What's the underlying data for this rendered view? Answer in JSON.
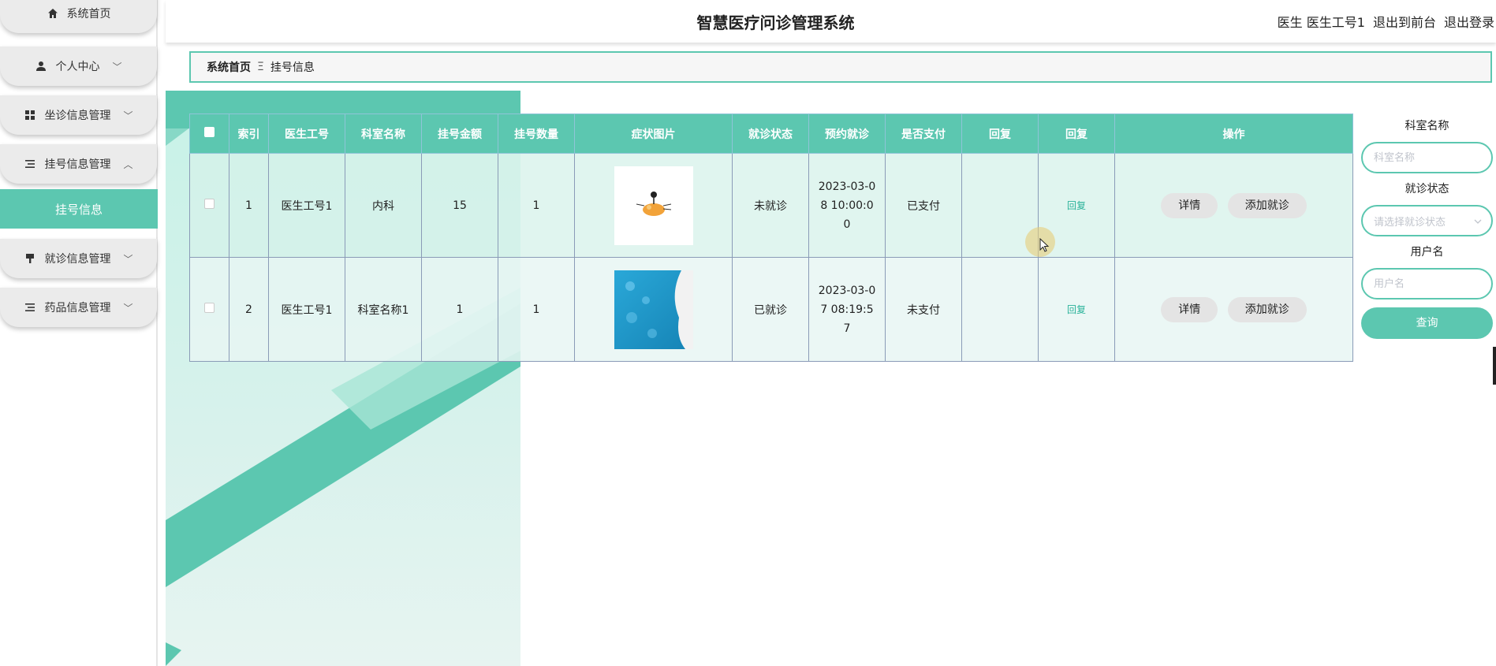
{
  "header": {
    "title": "智慧医疗问诊管理系统",
    "user_role": "医生",
    "user_name": "医生工号1",
    "back_to_front": "退出到前台",
    "logout": "退出登录"
  },
  "sidebar": {
    "items": [
      {
        "label": "系统首页",
        "icon": "home-icon"
      },
      {
        "label": "个人中心",
        "icon": "user-icon",
        "chevron": "﹀"
      },
      {
        "label": "坐诊信息管理",
        "icon": "grid-icon",
        "chevron": "﹀"
      },
      {
        "label": "挂号信息管理",
        "icon": "list-icon",
        "chevron": "︿"
      },
      {
        "label": "就诊信息管理",
        "icon": "brush-icon",
        "chevron": "﹀"
      },
      {
        "label": "药品信息管理",
        "icon": "list-icon",
        "chevron": "﹀"
      }
    ],
    "active_sub": "挂号信息"
  },
  "breadcrumb": {
    "home": "系统首页",
    "separator": "Ξ",
    "current": "挂号信息"
  },
  "table": {
    "headers": [
      "索引",
      "医生工号",
      "科室名称",
      "挂号金额",
      "挂号数量",
      "症状图片",
      "就诊状态",
      "预约就诊",
      "是否支付",
      "回复",
      "回复",
      "操作"
    ],
    "rows": [
      {
        "index": "1",
        "doctor_id": "医生工号1",
        "department": "内科",
        "amount": "15",
        "quantity": "1",
        "image": "cartoon-image",
        "status": "未就诊",
        "appointment": "2023-03-08 10:00:00",
        "paid": "已支付",
        "reply_text": "",
        "reply_link": "回复",
        "btn_detail": "详情",
        "btn_add": "添加就诊"
      },
      {
        "index": "2",
        "doctor_id": "医生工号1",
        "department": "科室名称1",
        "amount": "1",
        "quantity": "1",
        "image": "medical-photo",
        "status": "已就诊",
        "appointment": "2023-03-07 08:19:57",
        "paid": "未支付",
        "reply_text": "",
        "reply_link": "回复",
        "btn_detail": "详情",
        "btn_add": "添加就诊"
      }
    ]
  },
  "search": {
    "dept_label": "科室名称",
    "dept_placeholder": "科室名称",
    "status_label": "就诊状态",
    "status_placeholder": "请选择就诊状态",
    "user_label": "用户名",
    "user_placeholder": "用户名",
    "button": "查询"
  },
  "colors": {
    "accent": "#5cc7b0",
    "sidebar_bg": "#ebebeb"
  }
}
